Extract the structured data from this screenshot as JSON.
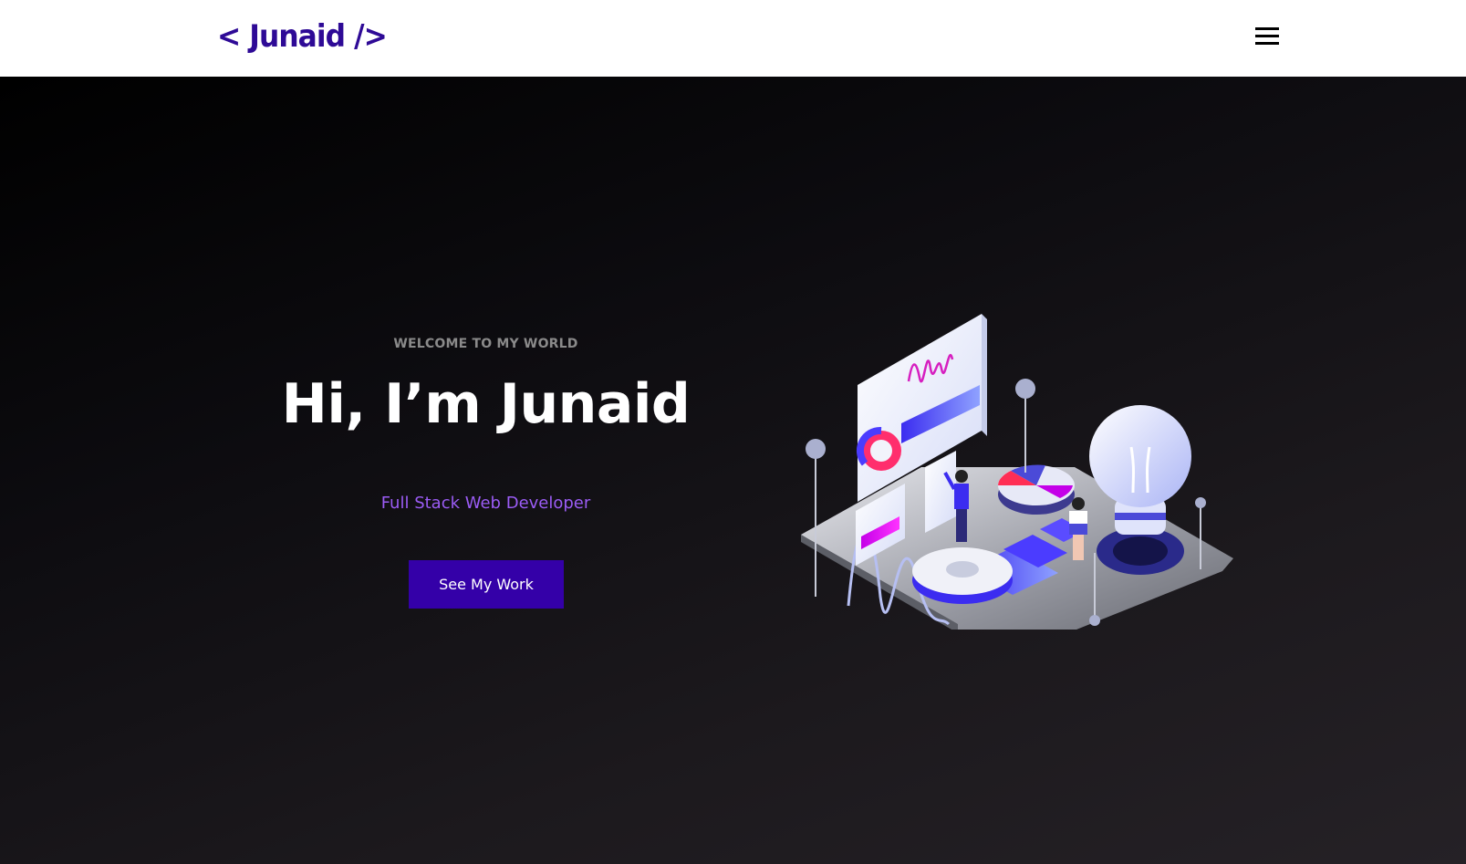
{
  "navbar": {
    "logo": "< Junaid />",
    "menu_icon": "hamburger-menu-icon"
  },
  "hero": {
    "eyebrow": "WELCOME TO MY WORLD",
    "headline": "Hi, I’m Junaid",
    "subtitle": "Full Stack Web Developer",
    "cta_label": "See My Work",
    "illustration_icon": "isometric-data-illustration"
  },
  "colors": {
    "brand": "#2e0a96",
    "button": "#3400a8",
    "subtitle": "#9b5cf5"
  }
}
